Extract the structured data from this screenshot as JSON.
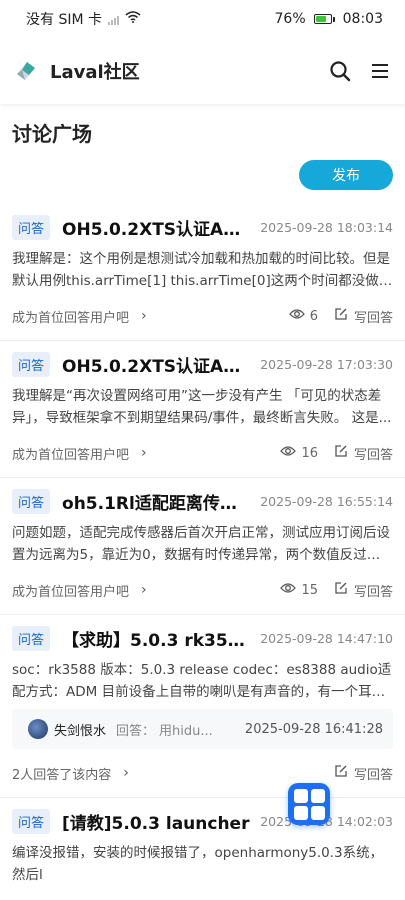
{
  "status": {
    "carrier": "没有 SIM 卡",
    "battery": "76%",
    "time": "08:03"
  },
  "header": {
    "title": "Laval社区"
  },
  "page": {
    "title": "讨论广场",
    "publish": "发布"
  },
  "posts": [
    {
      "tag": "问答",
      "title": "OH5.0.2XTS认证ActsA...",
      "time": "2025-09-28 18:03:14",
      "excerpt": "我理解是：这个用例是想测试冷加载和热加载的时间比较。但是默认用例this.arrTime[1] this.arrTime[0]这两个时间都没做记录冷...",
      "footer": "成为首位回答用户吧",
      "views": "6",
      "answer": "写回答"
    },
    {
      "tag": "问答",
      "title": "OH5.0.2XTS认证ActsA...",
      "time": "2025-09-28 17:03:30",
      "excerpt": "我理解是“再次设置网络可用”这一步没有产生 「可见的状态差异」，导致框架拿不到期望结果码/事件，最终断言失败。 这是...",
      "footer": "成为首位回答用户吧",
      "views": "16",
      "answer": "写回答"
    },
    {
      "tag": "问答",
      "title": "oh5.1Rl适配距离传感...",
      "time": "2025-09-28 16:55:14",
      "excerpt": "问题如题，适配完成传感器后首次开启正常，测试应用订阅后设置为远离为5，靠近为0，数据有时传递异常，两个数值反过来；设...",
      "footer": "成为首位回答用户吧",
      "views": "15",
      "answer": "写回答"
    },
    {
      "tag": "问答",
      "title": "【求助】5.0.3 rk3588 ...",
      "time": "2025-09-28 14:47:10",
      "excerpt": "soc：rk3588 版本：5.0.3 release codec：es8388 audio适配方式：ADM 目前设备上自带的喇叭是有声音的，有一个耳机孔，...",
      "reply": {
        "user": "失剑恨水",
        "label": "回答：",
        "text": "用hidu...",
        "time": "2025-09-28 16:41:28"
      },
      "footer": "2人回答了该内容",
      "answer": "写回答"
    },
    {
      "tag": "问答",
      "title": "[请教]5.0.3 launcher",
      "time": "2025-09-28 14:02:03",
      "excerpt": "编译没报错，安装的时候报错了，openharmony5.0.3系统，然后l"
    }
  ]
}
